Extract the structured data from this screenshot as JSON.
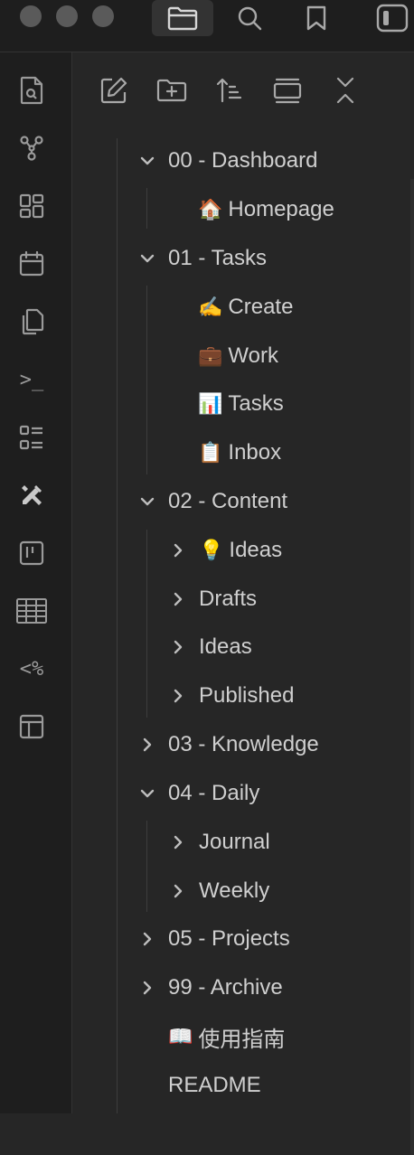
{
  "titlebar": {
    "icons": [
      "folder-icon",
      "search-icon",
      "bookmark-icon",
      "sidebar-toggle-icon"
    ]
  },
  "ribbon": {
    "icons": [
      "search-file-icon",
      "graph-icon",
      "grid-icon",
      "calendar-icon",
      "copy-icon",
      "terminal-icon",
      "list-icon",
      "tools-icon",
      "kanban-icon",
      "table-icon",
      "templater-icon",
      "layout-icon"
    ],
    "terminal_text": ">_",
    "templater_text": "<%"
  },
  "explorer": {
    "nav_icons": [
      "new-note-icon",
      "new-folder-icon",
      "sort-icon",
      "collapse-view-icon",
      "collapse-all-icon"
    ],
    "tree": [
      {
        "label": "00 - Dashboard",
        "type": "folder",
        "state": "open",
        "depth": 0
      },
      {
        "label": "Homepage",
        "icon": "🏠",
        "type": "file",
        "depth": 1
      },
      {
        "label": "01 - Tasks",
        "type": "folder",
        "state": "open",
        "depth": 0
      },
      {
        "label": "Create",
        "icon": "✍️",
        "type": "file",
        "depth": 1
      },
      {
        "label": "Work",
        "icon": "💼",
        "type": "file",
        "depth": 1
      },
      {
        "label": "Tasks",
        "icon": "📊",
        "type": "file",
        "depth": 1
      },
      {
        "label": "Inbox",
        "icon": "📋",
        "type": "file",
        "depth": 1
      },
      {
        "label": "02 - Content",
        "type": "folder",
        "state": "open",
        "depth": 0
      },
      {
        "label": "Ideas",
        "icon": "💡",
        "type": "folder",
        "state": "closed",
        "depth": 1
      },
      {
        "label": "Drafts",
        "type": "folder",
        "state": "closed",
        "depth": 1
      },
      {
        "label": "Ideas",
        "type": "folder",
        "state": "closed",
        "depth": 1
      },
      {
        "label": "Published",
        "type": "folder",
        "state": "closed",
        "depth": 1
      },
      {
        "label": "03 - Knowledge",
        "type": "folder",
        "state": "closed",
        "depth": 0
      },
      {
        "label": "04 - Daily",
        "type": "folder",
        "state": "open",
        "depth": 0
      },
      {
        "label": "Journal",
        "type": "folder",
        "state": "closed",
        "depth": 1
      },
      {
        "label": "Weekly",
        "type": "folder",
        "state": "closed",
        "depth": 1
      },
      {
        "label": "05 - Projects",
        "type": "folder",
        "state": "closed",
        "depth": 0
      },
      {
        "label": "99 - Archive",
        "type": "folder",
        "state": "closed",
        "depth": 0
      },
      {
        "label": "使用指南",
        "icon": "📖",
        "type": "file",
        "depth": 0
      },
      {
        "label": "README",
        "type": "file",
        "depth": 0
      }
    ]
  }
}
